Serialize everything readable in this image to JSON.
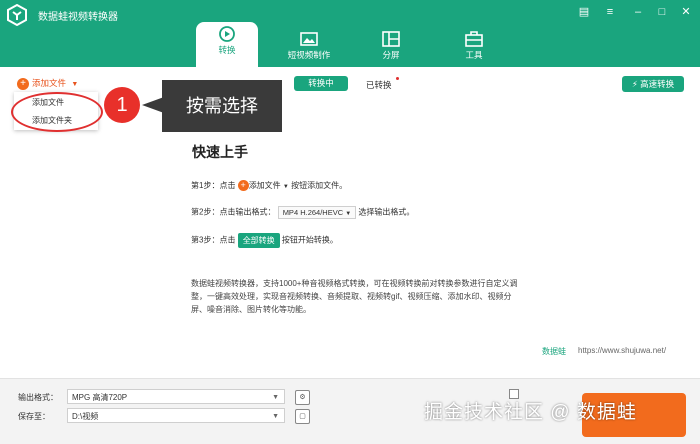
{
  "app": {
    "title": "数据蛙视频转换器"
  },
  "window_controls": [
    "message-icon",
    "menu-icon",
    "minimize-icon",
    "maximize-icon",
    "close-icon"
  ],
  "tabs": [
    {
      "label": "转换",
      "icon": "convert-icon",
      "active": true
    },
    {
      "label": "短视频制作",
      "icon": "short-video-icon",
      "active": false
    },
    {
      "label": "分屏",
      "icon": "split-screen-icon",
      "active": false
    },
    {
      "label": "工具",
      "icon": "toolbox-icon",
      "active": false
    }
  ],
  "toolbar": {
    "add_file": "添加文件",
    "dropdown": [
      "添加文件",
      "添加文件夹"
    ],
    "converting": "转换中",
    "converted": "已转换",
    "fast_convert": "高速转换"
  },
  "annotation": {
    "number": "1",
    "text": "按需选择"
  },
  "quick_start": {
    "title": "快速上手",
    "step1_prefix": "第1步：点击",
    "step1_button": "添加文件",
    "step1_suffix": "按钮添加文件。",
    "step2_prefix": "第2步：点击输出格式：",
    "step2_chip": "MP4 H.264/HEVC",
    "step2_suffix": "选择输出格式。",
    "step3_prefix": "第3步：点击",
    "step3_button": "全部转换",
    "step3_suffix": "按钮开始转换。"
  },
  "description": "数据蛙视频转换器，支持1000+种音视频格式转换，可在视频转换前对转换参数进行自定义调整，一键高效处理，实现音视频转换、音频提取、视频转gif、视频压缩、添加水印、视频分屏、噪音消除、图片转化等功能。",
  "footer": {
    "brand": "数据蛙",
    "url": "https://www.shujuwa.net/"
  },
  "bottom": {
    "output_label": "输出格式：",
    "output_value": "MPG 高清720P",
    "save_label": "保存至：",
    "save_value": "D:\\视频"
  },
  "watermark": "掘金技术社区 @ 数据蛙",
  "colors": {
    "brand": "#1aa57e",
    "accent": "#f26b1d",
    "annotation": "#e8302a"
  }
}
